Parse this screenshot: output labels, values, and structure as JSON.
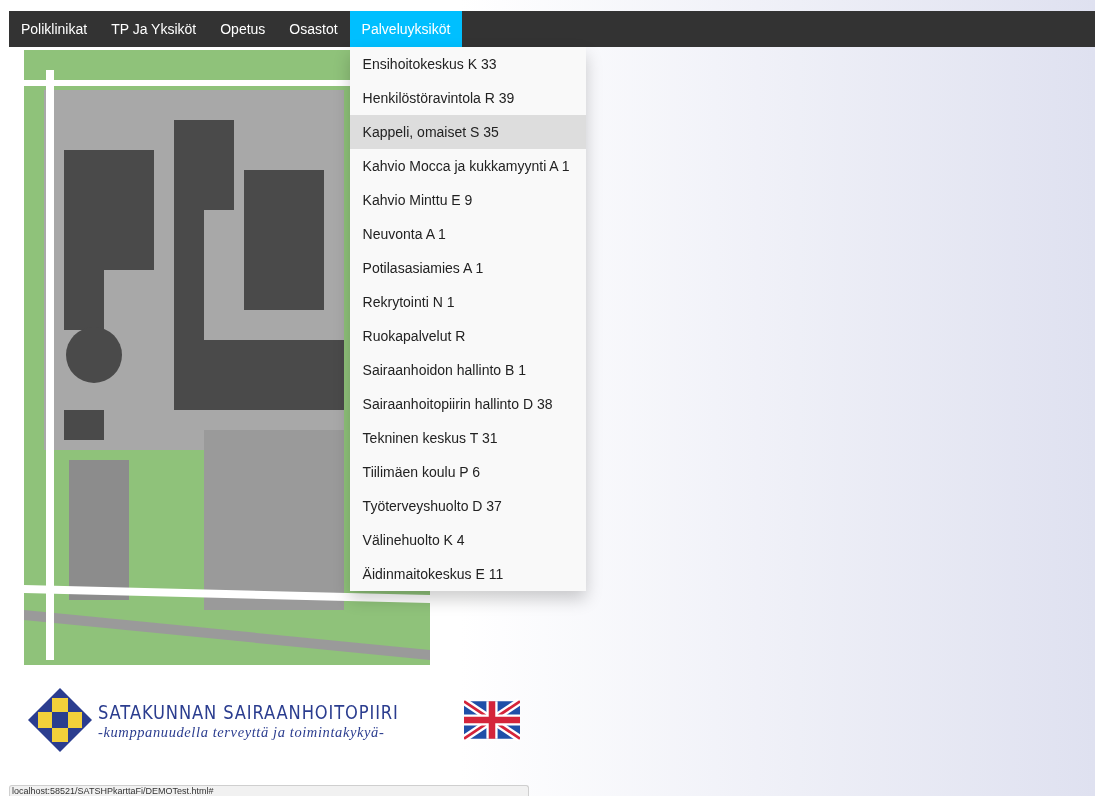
{
  "nav": {
    "tabs": [
      {
        "label": "Poliklinikat",
        "selected": false
      },
      {
        "label": "TP Ja Yksiköt",
        "selected": false
      },
      {
        "label": "Opetus",
        "selected": false
      },
      {
        "label": "Osastot",
        "selected": false
      },
      {
        "label": "Palveluyksiköt",
        "selected": true
      }
    ]
  },
  "menu": {
    "items": [
      {
        "label": "Ensihoitokeskus K 33",
        "selected": false
      },
      {
        "label": "Henkilöstöravintola R 39",
        "selected": false
      },
      {
        "label": "Kappeli, omaiset S 35",
        "selected": true
      },
      {
        "label": "Kahvio Mocca ja kukkamyynti A 1",
        "selected": false
      },
      {
        "label": "Kahvio Minttu E 9",
        "selected": false
      },
      {
        "label": "Neuvonta A 1",
        "selected": false
      },
      {
        "label": "Potilasasiamies A 1",
        "selected": false
      },
      {
        "label": "Rekrytointi N 1",
        "selected": false
      },
      {
        "label": "Ruokapalvelut R",
        "selected": false
      },
      {
        "label": "Sairaanhoidon hallinto B 1",
        "selected": false
      },
      {
        "label": "Sairaanhoitopiirin hallinto D 38",
        "selected": false
      },
      {
        "label": "Tekninen keskus T 31",
        "selected": false
      },
      {
        "label": "Tiilimäen koulu P 6",
        "selected": false
      },
      {
        "label": "Työterveyshuolto D 37",
        "selected": false
      },
      {
        "label": "Välinehuolto K 4",
        "selected": false
      },
      {
        "label": "Äidinmaitokeskus E 11",
        "selected": false
      }
    ]
  },
  "logo": {
    "name": "SATAKUNNAN SAIRAANHOITOPIIRI",
    "slogan": "-kumppanuudella terveyttä ja toimintakykyä-"
  },
  "status_bar": {
    "url": "localhost:58521/SATSHPkarttaFi/DEMOTest.html#"
  }
}
